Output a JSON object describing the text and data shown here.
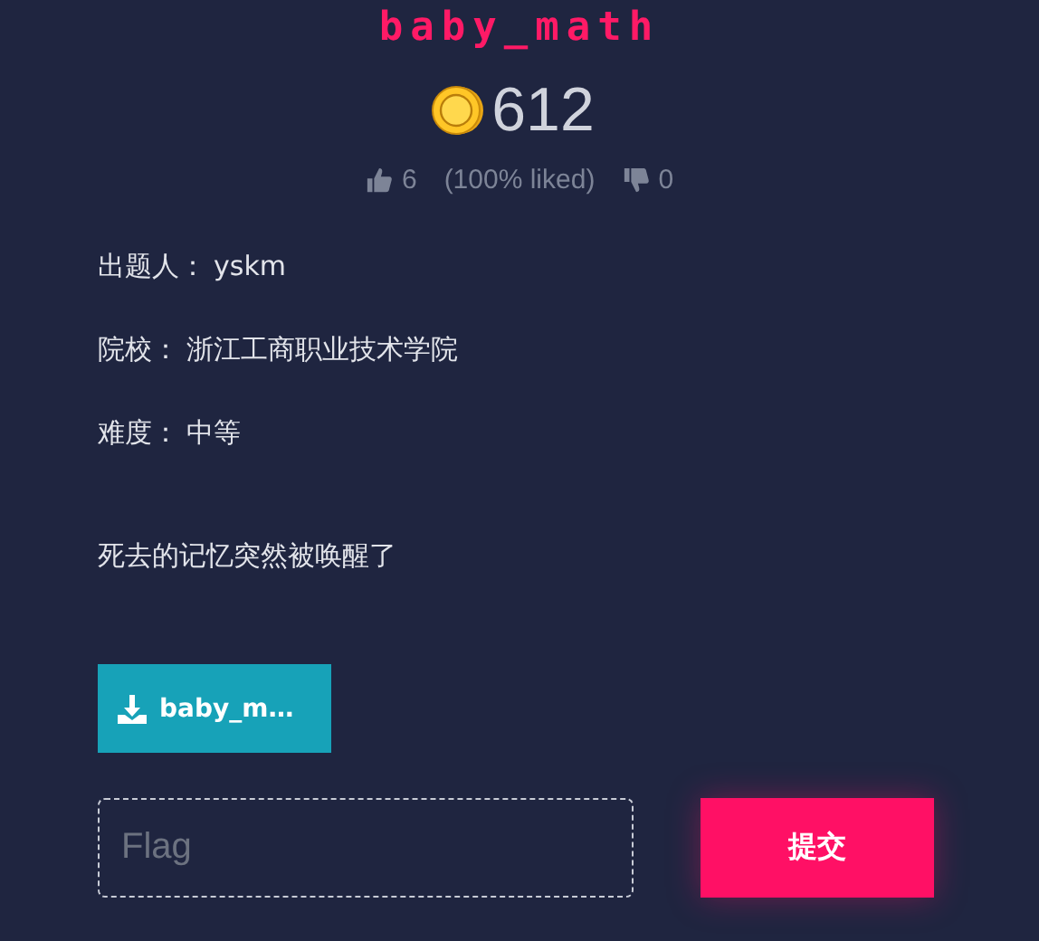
{
  "challenge": {
    "title": "baby_math",
    "points": "612",
    "likes": "6",
    "liked_percent": "(100% liked)",
    "dislikes": "0"
  },
  "details": [
    {
      "label": "出题人：",
      "value": "yskm"
    },
    {
      "label": "院校：",
      "value": "浙江工商职业技术学院"
    },
    {
      "label": "难度：",
      "value": "中等"
    }
  ],
  "description": "死去的记忆突然被唤醒了",
  "file_button": "baby_m…",
  "flag_field": {
    "placeholder": "Flag"
  },
  "submit_button": "提交"
}
